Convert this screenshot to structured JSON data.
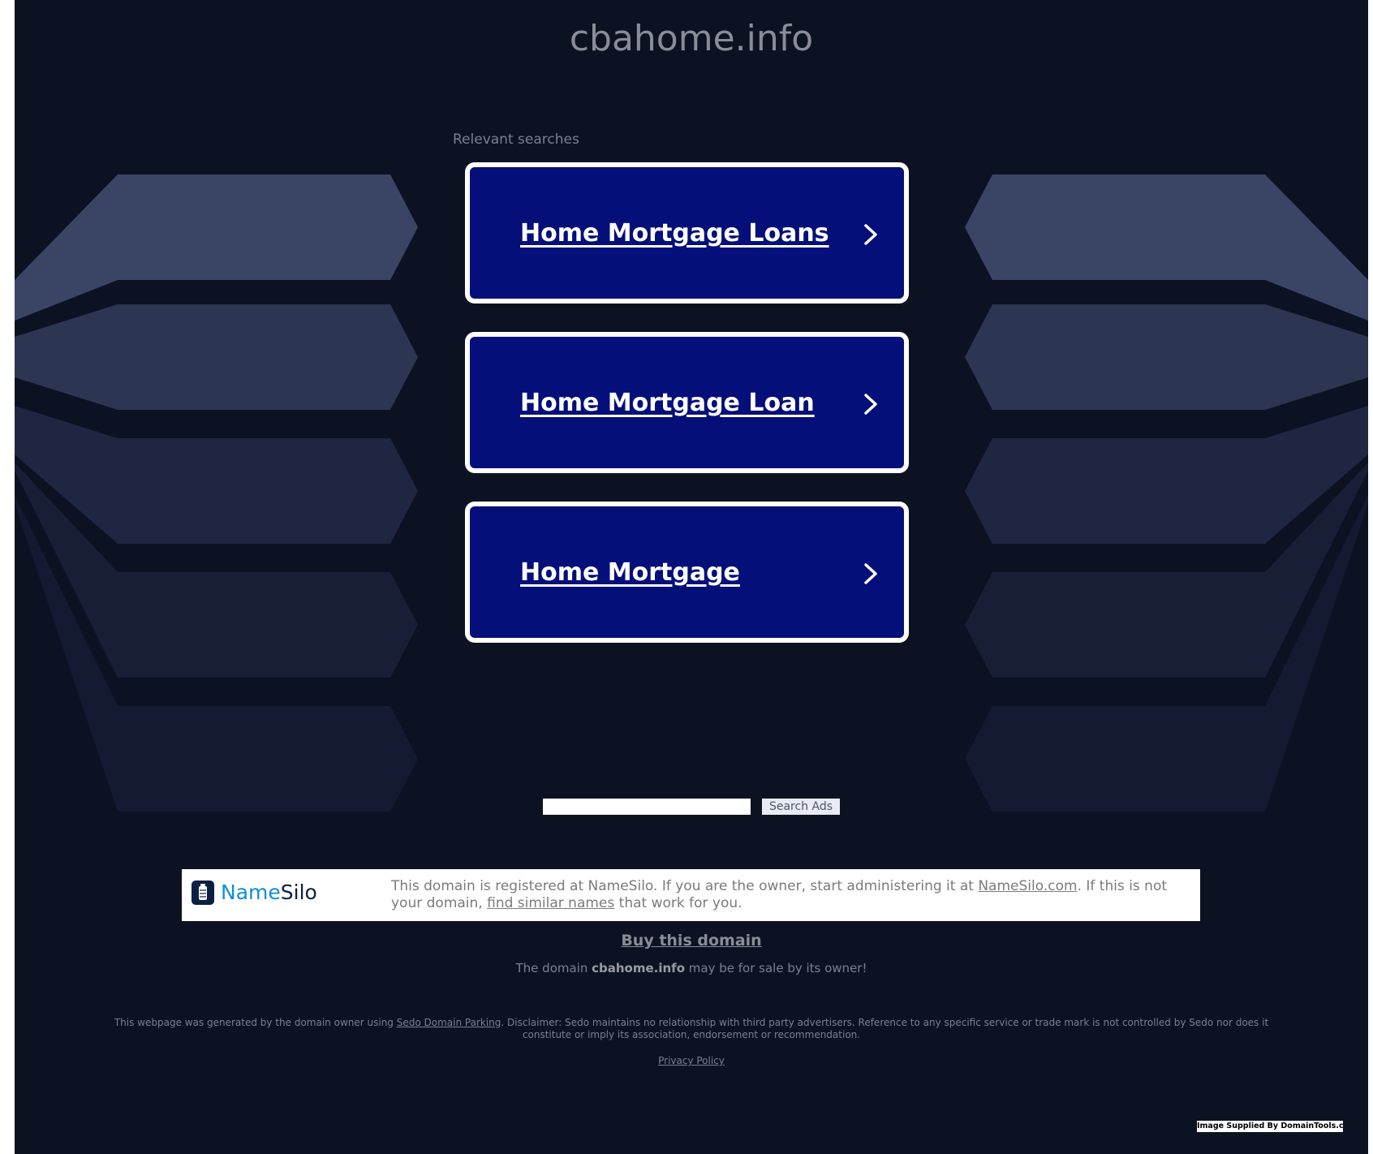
{
  "page": {
    "domain_title": "cbahome.info",
    "relevant_searches_label": "Relevant searches"
  },
  "results": [
    {
      "label": "Home Mortgage Loans"
    },
    {
      "label": "Home Mortgage Loan"
    },
    {
      "label": "Home Mortgage"
    }
  ],
  "search": {
    "input_value": "",
    "button_label": "Search Ads"
  },
  "registrar": {
    "logo_name": "Name",
    "logo_silo": "Silo",
    "text_before": "This domain is registered at NameSilo. If you are the owner, start administering it at ",
    "link1": "NameSilo.com",
    "text_middle": ". If this is not your domain, ",
    "link2": "find similar names",
    "text_after": " that work for you."
  },
  "buy": {
    "link_label": "Buy this domain",
    "sale_prefix": "The domain ",
    "sale_domain": "cbahome.info",
    "sale_suffix": " may be for sale by its owner!"
  },
  "footer": {
    "disclaimer_prefix": "This webpage was generated by the domain owner using ",
    "sedo_link": "Sedo Domain Parking",
    "disclaimer_suffix": ". Disclaimer: Sedo maintains no relationship with third party advertisers. Reference to any specific service or trade mark is not controlled by Sedo nor does it constitute or imply its association, endorsement or recommendation.",
    "privacy_label": "Privacy Policy",
    "image_credit": "Image Supplied By DomainTools.com"
  },
  "colors": {
    "background": "#0d1223",
    "result_box": "#040f7a",
    "namesilo_blue": "#0d8fd8",
    "namesilo_dark": "#0b1f45"
  },
  "icons": {
    "result_arrow": "chevron-right-icon",
    "registrar_logo": "namesilo-logo-icon"
  }
}
